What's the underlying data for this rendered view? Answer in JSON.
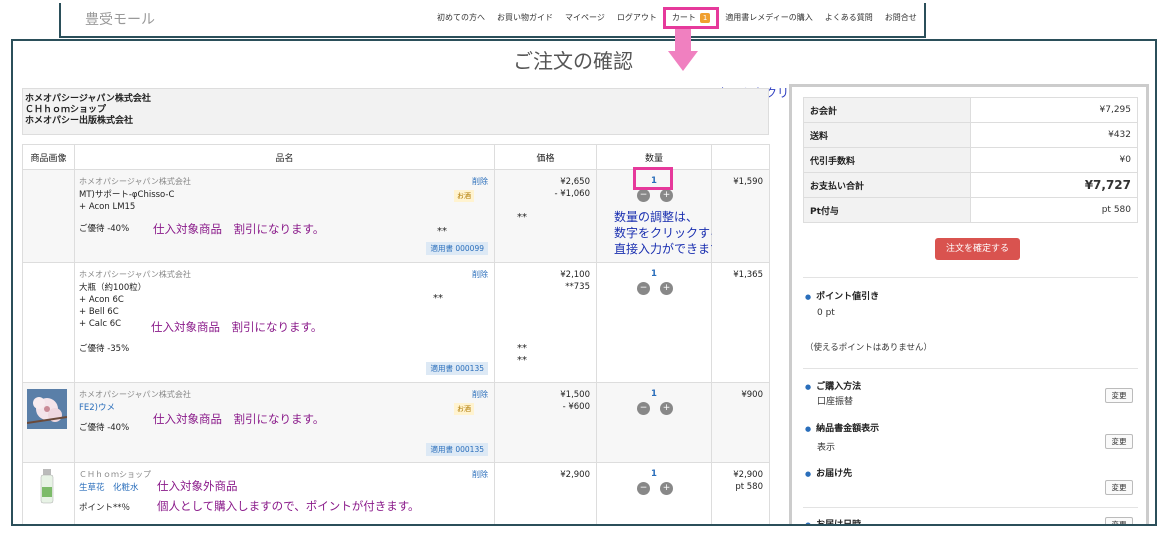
{
  "header": {
    "logo": "豊受モール",
    "nav": [
      "初めての方へ",
      "お買い物ガイド",
      "マイページ",
      "ログアウト"
    ],
    "cart_label": "カート",
    "cart_count": "1",
    "nav_after": [
      "適用書レメディーの購入",
      "よくある質問",
      "お問合せ"
    ]
  },
  "page_title": "ご注文の確認",
  "annotations": {
    "cart_click": "カートをクリック",
    "qty_note": [
      "数量の調整は、",
      "数字をクリックすると",
      "直接入力ができます。"
    ],
    "purchase_target": "仕入対象商品　割引になります。",
    "non_target": "仕入対象外商品",
    "non_target_note": "個人として購入しますので、ポイントが付きます。",
    "stars": "**"
  },
  "companies": [
    "ホメオパシージャパン株式会社",
    "ＣＨｈｏｍショップ",
    "ホメオパシー出版株式会社"
  ],
  "table": {
    "headers": [
      "商品画像",
      "品名",
      "価格",
      "数量",
      ""
    ],
    "remove_label": "削除",
    "osake_label": "お酒",
    "rows": [
      {
        "maker": "ホメオパシージャパン株式会社",
        "name": [
          "MT)サポート-φChisso-C",
          "+ Acon LM15"
        ],
        "discount": "ご優待 -40%",
        "voucher": "適用書 000099",
        "price": [
          "¥2,650",
          "- ¥1,060"
        ],
        "qty": "1",
        "subtotal": "¥1,590"
      },
      {
        "maker": "ホメオパシージャパン株式会社",
        "name": [
          "大瓶（約100粒）",
          "+ Acon 6C",
          "+ Bell 6C",
          "+ Calc 6C"
        ],
        "discount": "ご優待 -35%",
        "voucher": "適用書 000135",
        "price": [
          "¥2,100",
          "**735"
        ],
        "qty": "1",
        "subtotal": "¥1,365"
      },
      {
        "maker": "ホメオパシージャパン株式会社",
        "name": [
          "FE2)ウメ"
        ],
        "discount": "ご優待 -40%",
        "voucher": "適用書 000135",
        "price": [
          "¥1,500",
          "- ¥600"
        ],
        "qty": "1",
        "subtotal": "¥900"
      },
      {
        "maker": "ＣＨｈｏｍショップ",
        "name": [
          "生草花　化粧水"
        ],
        "discount": "ポイント**％",
        "price": [
          "¥2,900"
        ],
        "qty": "1",
        "subtotal": [
          "¥2,900",
          "pt 580"
        ]
      }
    ]
  },
  "summary": {
    "rows": [
      {
        "label": "お会計",
        "value": "¥7,295"
      },
      {
        "label": "送料",
        "value": "¥432"
      },
      {
        "label": "代引手数料",
        "value": "¥0"
      },
      {
        "label": "お支払い合計",
        "value": "¥7,727"
      },
      {
        "label": "Pt付与",
        "value": "pt 580"
      }
    ],
    "confirm_button": "注文を確定する",
    "point_discount": {
      "title": "ポイント値引き",
      "value": "0 pt",
      "note": "（使えるポイントはありません）"
    },
    "purchase_method": {
      "title": "ご購入方法",
      "value": "口座振替"
    },
    "invoice_amount": {
      "title": "納品書金額表示",
      "value": "表示"
    },
    "delivery_to": {
      "title": "お届け先"
    },
    "delivery_date": {
      "title": "お届け日時"
    },
    "change_label": "変更"
  }
}
